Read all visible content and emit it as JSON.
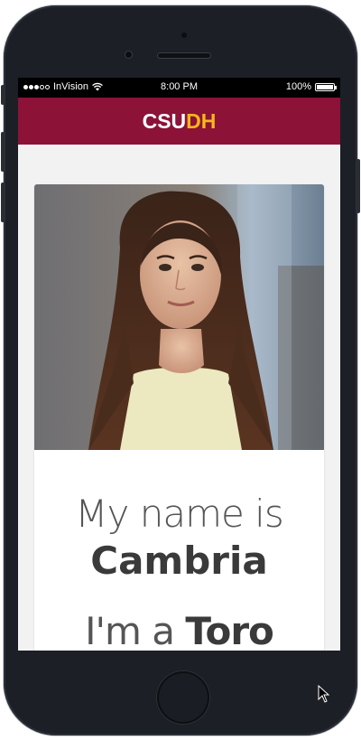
{
  "status_bar": {
    "carrier": "InVision",
    "time": "8:00 PM",
    "battery_text": "100%",
    "battery_level": 1.0
  },
  "header": {
    "logo_primary": "CSU",
    "logo_accent": "DH"
  },
  "profile": {
    "intro_text": "My name is",
    "name": "Cambria",
    "role_prefix": "I'm a",
    "role": "Toro"
  },
  "colors": {
    "brand_maroon": "#8c1238",
    "brand_gold": "#f4b81a",
    "device_body": "#1c1f26",
    "screen_background": "#f2f2f3"
  },
  "icons": {
    "wifi": "wifi-icon",
    "battery": "battery-icon",
    "signal": "signal-dots-icon",
    "cursor": "cursor-arrow-icon"
  }
}
